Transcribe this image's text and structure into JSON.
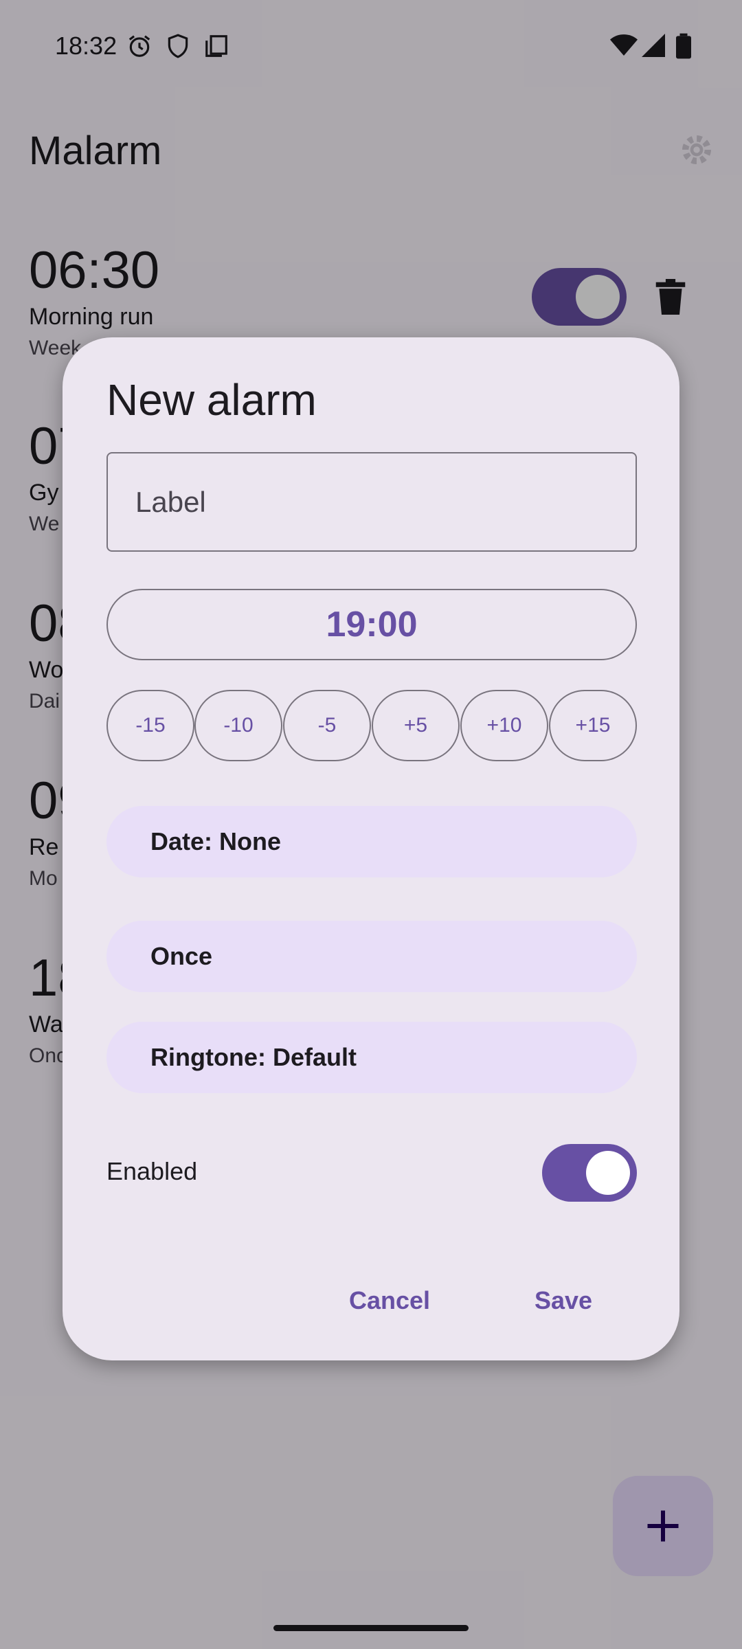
{
  "status_bar": {
    "time": "18:32",
    "left_icons": [
      "alarm-icon",
      "shield-icon",
      "copy-icon"
    ],
    "right_icons": [
      "wifi-icon",
      "signal-icon",
      "battery-icon"
    ]
  },
  "app": {
    "title": "Malarm",
    "settings_icon": "gear-icon"
  },
  "alarms": [
    {
      "time": "06:30",
      "label": "Morning run",
      "repeat": "Week",
      "enabled": true
    },
    {
      "time": "07",
      "label": "Gy",
      "repeat": "We",
      "enabled": true
    },
    {
      "time": "08",
      "label": "Wo",
      "repeat": "Dai",
      "enabled": true
    },
    {
      "time": "09",
      "label": "Re",
      "repeat": "Mo",
      "enabled": true
    },
    {
      "time": "18",
      "label": "Wa",
      "repeat": "Onc",
      "enabled": true
    }
  ],
  "fab": {
    "icon": "plus-icon"
  },
  "dialog": {
    "title": "New alarm",
    "label_placeholder": "Label",
    "label_value": "",
    "time": "19:00",
    "adjust_buttons": [
      "-15",
      "-10",
      "-5",
      "+5",
      "+10",
      "+15"
    ],
    "date_button": "Date: None",
    "repeat_button": "Once",
    "ringtone_button": "Ringtone: Default",
    "enabled_label": "Enabled",
    "enabled": true,
    "cancel_label": "Cancel",
    "save_label": "Save"
  },
  "colors": {
    "primary": "#6750a4",
    "surface_dialog": "#ece6f0",
    "tonal_container": "#e8def8",
    "outline": "#79747e",
    "scrim": "rgba(0,0,0,0.32)"
  }
}
